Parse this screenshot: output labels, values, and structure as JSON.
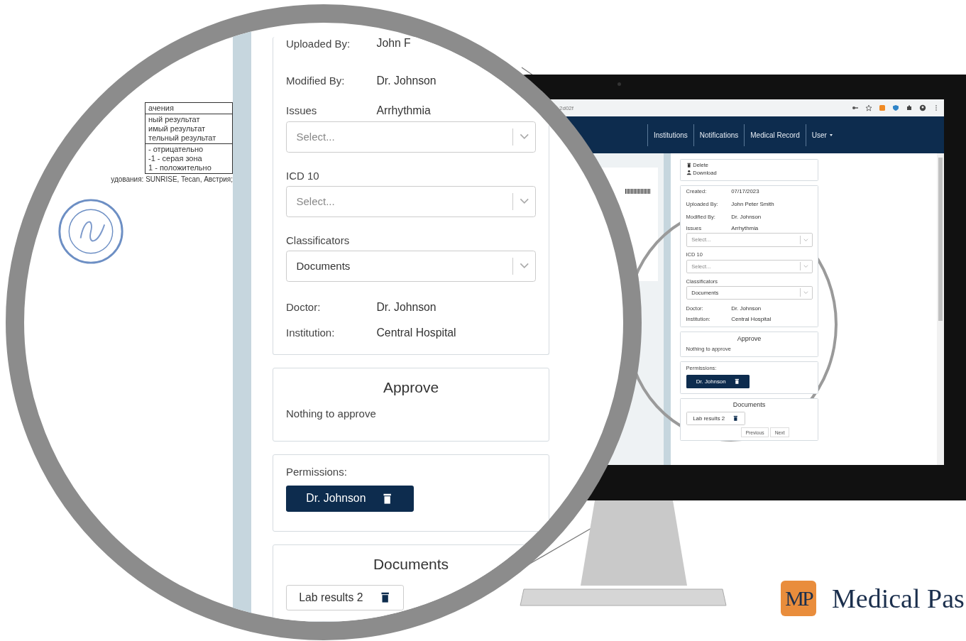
{
  "magnifier": {
    "document": {
      "table": [
        [
          "ачения"
        ],
        [
          "ный результат",
          "имый результат",
          "тельный результат"
        ],
        [
          "- отрицательно",
          "-1 - серая зона",
          "1 - положительно"
        ]
      ],
      "caption": "удования: SUNRISE, Tecan, Австрия;"
    },
    "panel": {
      "meta": [
        {
          "label": "Uploaded By:",
          "value": "John F"
        },
        {
          "label": "Modified By:",
          "value": "Dr. Johnson"
        }
      ],
      "selects": [
        {
          "label": "Issues",
          "label_value": "Arrhythmia",
          "placeholder": "Select..."
        },
        {
          "label": "ICD 10",
          "placeholder": "Select..."
        },
        {
          "label": "Classificators",
          "value": "Documents"
        }
      ],
      "people": [
        {
          "label": "Doctor:",
          "value": "Dr. Johnson"
        },
        {
          "label": "Institution:",
          "value": "Central Hospital"
        }
      ],
      "approve": {
        "title": "Approve",
        "text": "Nothing to approve"
      },
      "permissions": {
        "label": "Permissions:",
        "chips": [
          "Dr. Johnson"
        ]
      },
      "documents": {
        "title": "Documents",
        "files": [
          "Lab results 2"
        ]
      }
    }
  },
  "screen": {
    "browser": {
      "url": "2d02f"
    },
    "nav": [
      {
        "label": "Institutions",
        "kind": "link"
      },
      {
        "label": "Notifications",
        "kind": "link"
      },
      {
        "label": "Medical Record",
        "kind": "link"
      },
      {
        "label": "User",
        "kind": "dropdown"
      }
    ],
    "panel": {
      "actions": [
        {
          "kind": "delete",
          "label": "Delete"
        },
        {
          "kind": "download",
          "label": "Download"
        }
      ],
      "meta": [
        {
          "label": "Created:",
          "value": "07/17/2023"
        },
        {
          "label": "Uploaded By:",
          "value": "John Peter Smith"
        },
        {
          "label": "Modified By:",
          "value": "Dr. Johnson"
        }
      ],
      "selects": [
        {
          "label": "Issues",
          "label_value": "Arrhythmia",
          "placeholder": "Select..."
        },
        {
          "label": "ICD 10",
          "placeholder": "Select..."
        },
        {
          "label": "Classificators",
          "value": "Documents"
        }
      ],
      "people": [
        {
          "label": "Doctor:",
          "value": "Dr. Johnson"
        },
        {
          "label": "Institution:",
          "value": "Central Hospital"
        }
      ],
      "approve": {
        "title": "Approve",
        "text": "Nothing to approve"
      },
      "permissions": {
        "label": "Permissions:",
        "chips": [
          "Dr. Johnson"
        ]
      },
      "documents": {
        "title": "Documents",
        "files": [
          "Lab results 2"
        ],
        "pagination": [
          "Previous",
          "Next"
        ]
      }
    }
  },
  "logo": {
    "mark": "MP",
    "name": "Medical Pas"
  }
}
